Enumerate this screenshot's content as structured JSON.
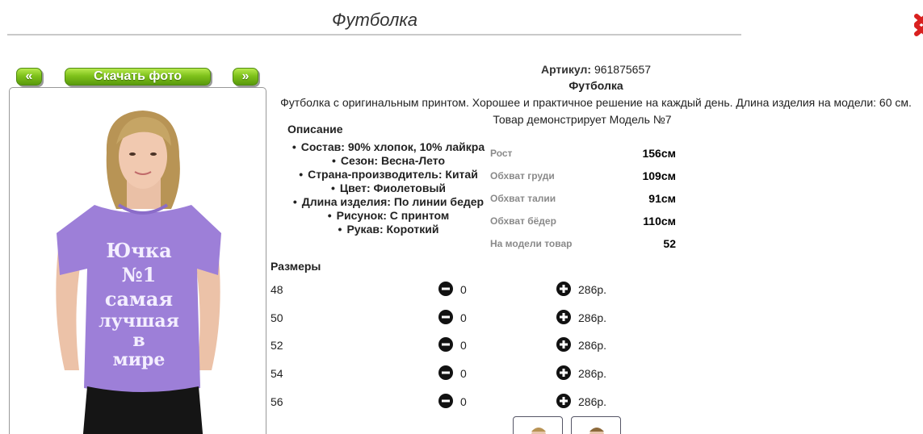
{
  "page": {
    "title": "Футболка"
  },
  "nav": {
    "prev_label": "«",
    "download_label": "Скачать фото",
    "next_label": "»"
  },
  "product": {
    "article_label": "Артикул:",
    "article_value": "961875657",
    "name": "Футболка",
    "description": "Футболка с оригинальным принтом. Хорошее и практичное решение на каждый день. Длина изделия на модели: 60 см.",
    "model_note": "Товар демонстрирует Модель №7",
    "print_text": [
      "Ючка",
      "№1",
      "самая",
      "лучшая",
      "в",
      "мире"
    ]
  },
  "details": {
    "title": "Описание",
    "features": [
      "Состав: 90% хлопок, 10% лайкра",
      "Сезон: Весна-Лето",
      "Страна-производитель: Китай",
      "Цвет: Фиолетовый",
      "Длина изделия: По линии бедер",
      "Рисунок: С принтом",
      "Рукав: Короткий"
    ]
  },
  "measurements": [
    {
      "label": "Рост",
      "value": "156см"
    },
    {
      "label": "Обхват груди",
      "value": "109см"
    },
    {
      "label": "Обхват талии",
      "value": "91см"
    },
    {
      "label": "Обхват бёдер",
      "value": "110см"
    },
    {
      "label": "На модели товар",
      "value": "52"
    }
  ],
  "sizes": {
    "title": "Размеры",
    "rows": [
      {
        "size": "48",
        "qty": "0",
        "price": "286р."
      },
      {
        "size": "50",
        "qty": "0",
        "price": "286р."
      },
      {
        "size": "52",
        "qty": "0",
        "price": "286р."
      },
      {
        "size": "54",
        "qty": "0",
        "price": "286р."
      },
      {
        "size": "56",
        "qty": "0",
        "price": "286р."
      }
    ]
  },
  "colors": {
    "accent_green": "#7fc21b",
    "shirt_purple": "#9d7fd8",
    "close_red": "#d9201f"
  },
  "icons": {
    "minus": "minus-circle-icon",
    "plus": "plus-circle-icon",
    "close": "close-icon"
  }
}
